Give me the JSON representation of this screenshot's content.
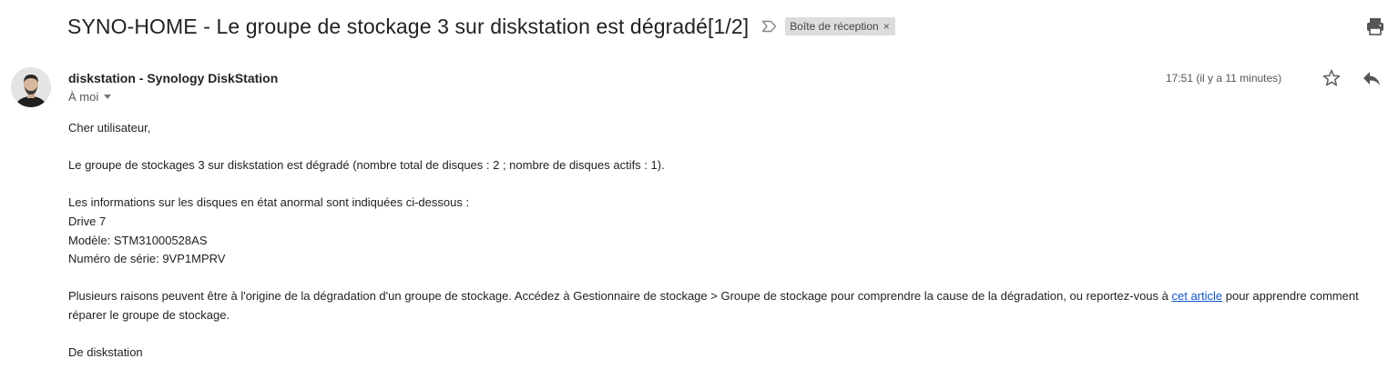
{
  "email": {
    "subject": "SYNO-HOME - Le groupe de stockage 3 sur diskstation est dégradé[1/2]",
    "label": "Boîte de réception",
    "label_remove": "×",
    "sender": "diskstation - Synology DiskStation",
    "to": "À moi",
    "time": "17:51 (il y a 11 minutes)",
    "body": {
      "greeting": "Cher utilisateur,",
      "line1": "Le groupe de stockages 3 sur diskstation est dégradé (nombre total de disques : 2 ; nombre de disques actifs : 1).",
      "info_intro": "Les informations sur les disques en état anormal sont indiquées ci-dessous :",
      "drive": "Drive 7",
      "model": "Modèle: STM31000528AS",
      "serial": "Numéro de série: 9VP1MPRV",
      "para_part1": "Plusieurs raisons peuvent être à l'origine de la dégradation d'un groupe de stockage. Accédez à Gestionnaire de stockage > Groupe de stockage pour comprendre la cause de la dégradation, ou reportez-vous à ",
      "link_text": "cet article",
      "para_part2": " pour apprendre comment réparer le groupe de stockage.",
      "signoff": "De diskstation"
    }
  },
  "icons": {
    "importance": "importance-marker-icon",
    "print": "print-icon",
    "star": "star-icon",
    "reply": "reply-icon",
    "avatar": "avatar"
  }
}
